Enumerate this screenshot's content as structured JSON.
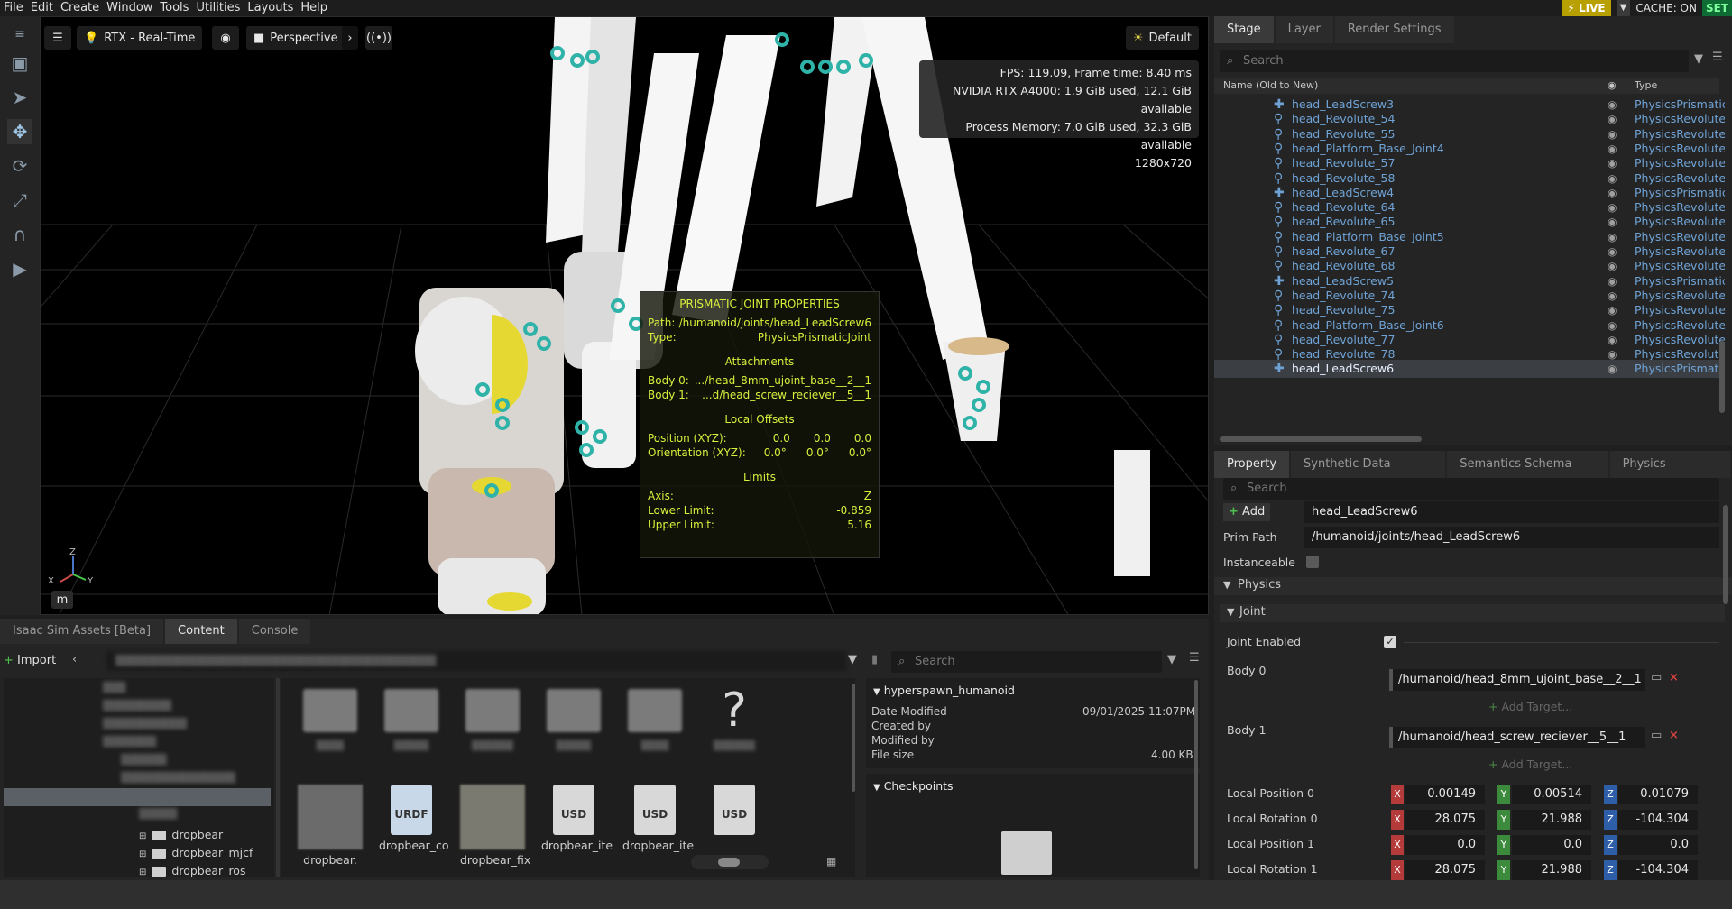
{
  "menubar": {
    "items": [
      "File",
      "Edit",
      "Create",
      "Window",
      "Tools",
      "Utilities",
      "Layouts",
      "Help"
    ],
    "live_label": "LIVE",
    "cache_label": "CACHE: ON",
    "set_label": "SET"
  },
  "viewport": {
    "render_mode": "RTX - Real-Time",
    "camera": "Perspective",
    "lighting": "Default",
    "unit_badge": "m",
    "axes": {
      "z": "Z",
      "x": "X",
      "y": "Y"
    },
    "stats": {
      "fps": "FPS: 119.09, Frame time: 8.40 ms",
      "gpu": "NVIDIA RTX A4000: 1.9 GiB used, 12.1 GiB available",
      "mem": "Process Memory: 7.0 GiB used, 32.3 GiB available",
      "res": "1280x720"
    },
    "joint_panel": {
      "title": "PRISMATIC JOINT PROPERTIES",
      "path_label": "Path:",
      "path_value": "/humanoid/joints/head_LeadScrew6",
      "type_label": "Type:",
      "type_value": "PhysicsPrismaticJoint",
      "attachments_header": "Attachments",
      "body0_label": "Body 0:",
      "body0_value": ".../head_8mm_ujoint_base__2__1",
      "body1_label": "Body 1:",
      "body1_value": "...d/head_screw_reciever__5__1",
      "offsets_header": "Local Offsets",
      "position_label": "Position (XYZ):",
      "position_values": [
        "0.0",
        "0.0",
        "0.0"
      ],
      "orientation_label": "Orientation (XYZ):",
      "orientation_values": [
        "0.0°",
        "0.0°",
        "0.0°"
      ],
      "limits_header": "Limits",
      "axis_label": "Axis:",
      "axis_value": "Z",
      "lower_label": "Lower Limit:",
      "lower_value": "-0.859",
      "upper_label": "Upper Limit:",
      "upper_value": "5.16"
    }
  },
  "stage": {
    "tabs": [
      "Stage",
      "Layer",
      "Render Settings"
    ],
    "search_placeholder": "Search",
    "col_name": "Name (Old to New)",
    "col_type": "Type",
    "rows": [
      {
        "name": "head_LeadScrew3",
        "type": "PhysicsPrismatic",
        "kind": "prismatic"
      },
      {
        "name": "head_Revolute_54",
        "type": "PhysicsRevolute",
        "kind": "revolute"
      },
      {
        "name": "head_Revolute_55",
        "type": "PhysicsRevolute",
        "kind": "revolute"
      },
      {
        "name": "head_Platform_Base_Joint4",
        "type": "PhysicsRevolute",
        "kind": "revolute"
      },
      {
        "name": "head_Revolute_57",
        "type": "PhysicsRevolute",
        "kind": "revolute"
      },
      {
        "name": "head_Revolute_58",
        "type": "PhysicsRevolute",
        "kind": "revolute"
      },
      {
        "name": "head_LeadScrew4",
        "type": "PhysicsPrismatic",
        "kind": "prismatic"
      },
      {
        "name": "head_Revolute_64",
        "type": "PhysicsRevolute",
        "kind": "revolute"
      },
      {
        "name": "head_Revolute_65",
        "type": "PhysicsRevolute",
        "kind": "revolute"
      },
      {
        "name": "head_Platform_Base_Joint5",
        "type": "PhysicsRevolute",
        "kind": "revolute"
      },
      {
        "name": "head_Revolute_67",
        "type": "PhysicsRevolute",
        "kind": "revolute"
      },
      {
        "name": "head_Revolute_68",
        "type": "PhysicsRevolute",
        "kind": "revolute"
      },
      {
        "name": "head_LeadScrew5",
        "type": "PhysicsPrismatic",
        "kind": "prismatic"
      },
      {
        "name": "head_Revolute_74",
        "type": "PhysicsRevolute",
        "kind": "revolute"
      },
      {
        "name": "head_Revolute_75",
        "type": "PhysicsRevolute",
        "kind": "revolute"
      },
      {
        "name": "head_Platform_Base_Joint6",
        "type": "PhysicsRevolute",
        "kind": "revolute"
      },
      {
        "name": "head_Revolute_77",
        "type": "PhysicsRevolute",
        "kind": "revolute"
      },
      {
        "name": "head_Revolute_78",
        "type": "PhysicsRevolute",
        "kind": "revolute"
      },
      {
        "name": "head_LeadScrew6",
        "type": "PhysicsPrismatic",
        "kind": "prismatic"
      }
    ]
  },
  "property": {
    "tabs": [
      "Property",
      "Synthetic Data Recorder",
      "Semantics Schema Editor",
      "Physics Inspector:"
    ],
    "search_placeholder": "Search",
    "add_label": "Add",
    "prim_name": "head_LeadScrew6",
    "prim_path_label": "Prim Path",
    "prim_path": "/humanoid/joints/head_LeadScrew6",
    "instanceable_label": "Instanceable",
    "physics_header": "Physics",
    "joint_header": "Joint",
    "joint_enabled_label": "Joint Enabled",
    "body0_label": "Body 0",
    "body0_value": "/humanoid/head_8mm_ujoint_base__2__1",
    "body1_label": "Body 1",
    "body1_value": "/humanoid/head_screw_reciever__5__1",
    "add_target_label": "Add Target...",
    "local_pos0_label": "Local Position 0",
    "local_pos0": [
      "0.00149",
      "0.00514",
      "0.01079"
    ],
    "local_rot0_label": "Local Rotation 0",
    "local_rot0": [
      "28.075",
      "21.988",
      "-104.304"
    ],
    "local_pos1_label": "Local Position 1",
    "local_pos1": [
      "0.0",
      "0.0",
      "0.0"
    ],
    "local_rot1_label": "Local Rotation 1",
    "local_rot1": [
      "28.075",
      "21.988",
      "-104.304"
    ]
  },
  "bottom": {
    "tabs": [
      "Isaac Sim Assets [Beta]",
      "Content",
      "Console"
    ],
    "import_label": "Import",
    "search_placeholder": "Search",
    "tree": [
      "dropbear",
      "dropbear_mjcf",
      "dropbear_ros"
    ],
    "thumbs": [
      "dropbear.",
      "dropbear_co",
      "dropbear_fix",
      "dropbear_ite",
      "dropbear_ite"
    ],
    "detail_title": "hyperspawn_humanoid",
    "date_label": "Date Modified",
    "date_value": "09/01/2025 11:07PM",
    "created_label": "Created by",
    "modified_label": "Modified by",
    "size_label": "File size",
    "size_value": "4.00 KB",
    "checkpoints_label": "Checkpoints"
  }
}
